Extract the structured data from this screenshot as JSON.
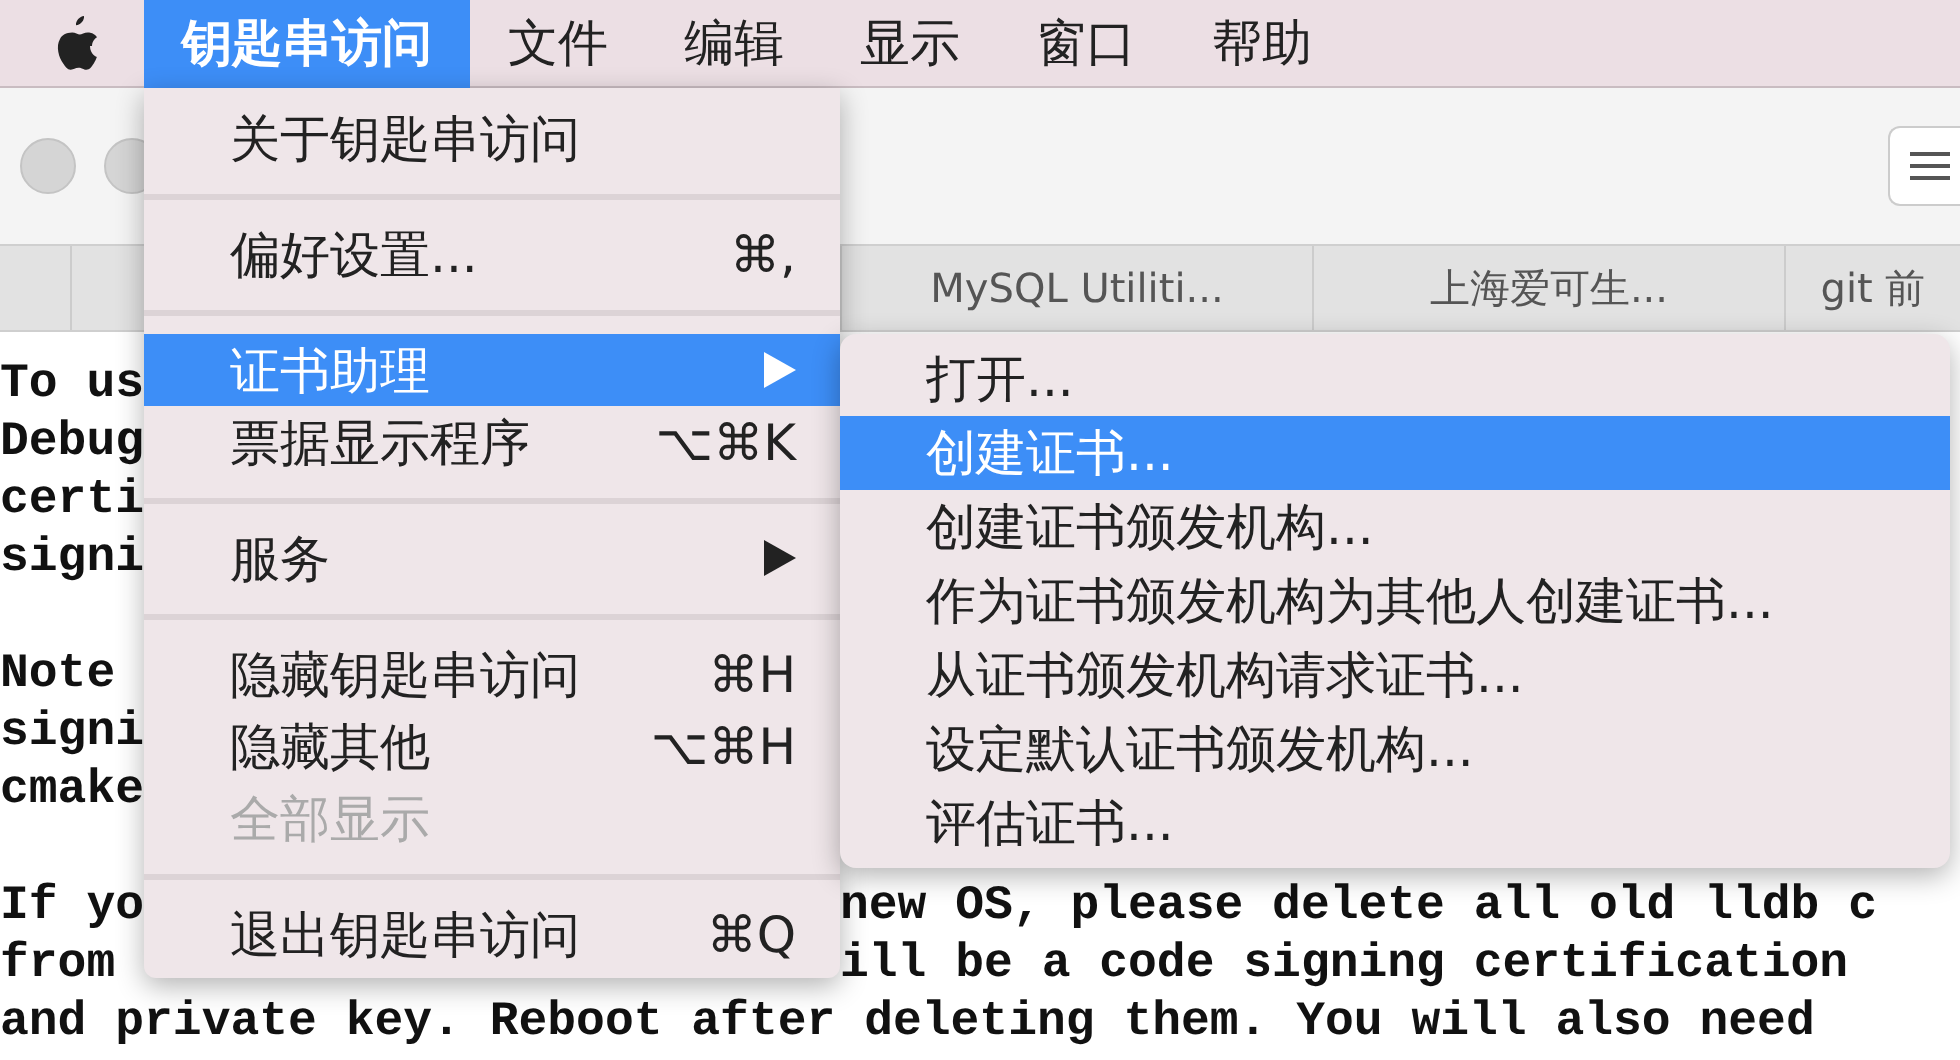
{
  "menu_bar": {
    "items": [
      {
        "label": "钥匙串访问",
        "selected": true
      },
      {
        "label": "文件",
        "selected": false
      },
      {
        "label": "编辑",
        "selected": false
      },
      {
        "label": "显示",
        "selected": false
      },
      {
        "label": "窗口",
        "selected": false
      },
      {
        "label": "帮助",
        "selected": false
      }
    ]
  },
  "tabs": [
    {
      "label": "MySQL Utiliti..."
    },
    {
      "label": "上海爱可生..."
    },
    {
      "label": "git 前"
    }
  ],
  "document": {
    "paragraphs": [
      [
        {
          "left": "To us"
        },
        {
          "left": "Debug"
        },
        {
          "left": "certi"
        },
        {
          "left": "signi"
        }
      ],
      [
        {
          "left": "Note"
        },
        {
          "left": "signi"
        },
        {
          "left": "cmake"
        }
      ],
      [
        {
          "left": "If yo",
          "right": "new OS, please delete all old lldb c"
        },
        {
          "left": "from",
          "right": "ill be a code signing certification"
        },
        {
          "text": "and private key. Reboot after deleting them. You will also need"
        }
      ]
    ]
  },
  "menu": {
    "groups": [
      [
        {
          "label": "关于钥匙串访问",
          "selected": false,
          "disabled": false,
          "submenu": false
        }
      ],
      [
        {
          "label": "偏好设置...",
          "shortcut": "⌘,",
          "selected": false,
          "disabled": false,
          "submenu": false
        }
      ],
      [
        {
          "label": "证书助理",
          "selected": true,
          "disabled": false,
          "submenu": true
        },
        {
          "label": "票据显示程序",
          "shortcut": "⌥⌘K",
          "selected": false,
          "disabled": false,
          "submenu": false
        }
      ],
      [
        {
          "label": "服务",
          "selected": false,
          "disabled": false,
          "submenu": true
        }
      ],
      [
        {
          "label": "隐藏钥匙串访问",
          "shortcut": "⌘H",
          "selected": false,
          "disabled": false,
          "submenu": false
        },
        {
          "label": "隐藏其他",
          "shortcut": "⌥⌘H",
          "selected": false,
          "disabled": false,
          "submenu": false
        },
        {
          "label": "全部显示",
          "selected": false,
          "disabled": true,
          "submenu": false
        }
      ],
      [
        {
          "label": "退出钥匙串访问",
          "shortcut": "⌘Q",
          "selected": false,
          "disabled": false,
          "submenu": false
        }
      ]
    ]
  },
  "submenu": {
    "items": [
      {
        "label": "打开...",
        "selected": false
      },
      {
        "label": "创建证书...",
        "selected": true
      },
      {
        "label": "创建证书颁发机构...",
        "selected": false
      },
      {
        "label": "作为证书颁发机构为其他人创建证书...",
        "selected": false
      },
      {
        "label": "从证书颁发机构请求证书...",
        "selected": false
      },
      {
        "label": "设定默认证书颁发机构...",
        "selected": false
      },
      {
        "label": "评估证书...",
        "selected": false
      }
    ]
  }
}
